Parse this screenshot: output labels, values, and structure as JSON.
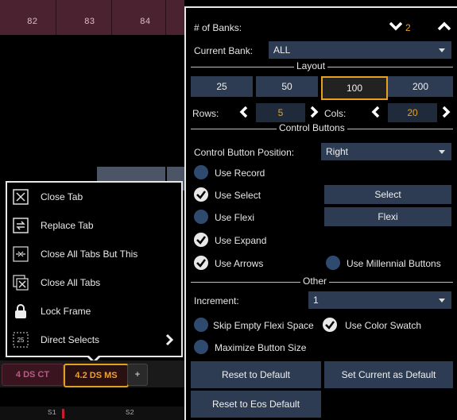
{
  "background": {
    "channels": [
      "82",
      "83",
      "84"
    ],
    "bottom_labels": [
      "S1",
      "S2"
    ]
  },
  "menu": {
    "items": [
      {
        "label": "Close Tab",
        "icon": "close-tab-icon"
      },
      {
        "label": "Replace Tab",
        "icon": "replace-tab-icon"
      },
      {
        "label": "Close All Tabs But This",
        "icon": "close-others-icon"
      },
      {
        "label": "Close All Tabs",
        "icon": "close-all-icon"
      },
      {
        "label": "Lock Frame",
        "icon": "lock-icon"
      },
      {
        "label": "Direct Selects",
        "icon": "direct-selects-icon",
        "submenu_arrow": "chevron-right-icon"
      }
    ]
  },
  "tabs": [
    {
      "label": "4 DS CT"
    },
    {
      "label": "4.2 DS MS",
      "active": true
    },
    {
      "label": "+"
    }
  ],
  "panel": {
    "banks_label": "# of Banks:",
    "banks_value": "2",
    "current_bank_label": "Current Bank:",
    "current_bank_value": "ALL",
    "layout_section": "Layout",
    "layout_options": [
      "25",
      "50",
      "100",
      "200"
    ],
    "layout_selected": "100",
    "rows_label": "Rows:",
    "rows_value": "5",
    "cols_label": "Cols:",
    "cols_value": "20",
    "control_section": "Control Buttons",
    "control_position_label": "Control Button Position:",
    "control_position_value": "Right",
    "use_record": {
      "label": "Use Record",
      "checked": false
    },
    "use_select": {
      "label": "Use Select",
      "checked": true
    },
    "select_button": "Select",
    "use_flexi": {
      "label": "Use Flexi",
      "checked": false
    },
    "flexi_button": "Flexi",
    "use_expand": {
      "label": "Use Expand",
      "checked": true
    },
    "use_arrows": {
      "label": "Use Arrows",
      "checked": true
    },
    "use_millennial": {
      "label": "Use Millennial Buttons",
      "checked": false
    },
    "other_section": "Other",
    "increment_label": "Increment:",
    "increment_value": "1",
    "skip_empty": {
      "label": "Skip Empty Flexi Space",
      "checked": false
    },
    "color_swatch": {
      "label": "Use Color Swatch",
      "checked": true
    },
    "maximize": {
      "label": "Maximize Button Size",
      "checked": false
    },
    "reset_default": "Reset to Default",
    "set_current_default": "Set Current as Default",
    "reset_eos": "Reset to Eos Default"
  },
  "colors": {
    "accent": "#e8a020",
    "button": "#2d3c52",
    "checkbox_off": "#2e4a6e"
  }
}
